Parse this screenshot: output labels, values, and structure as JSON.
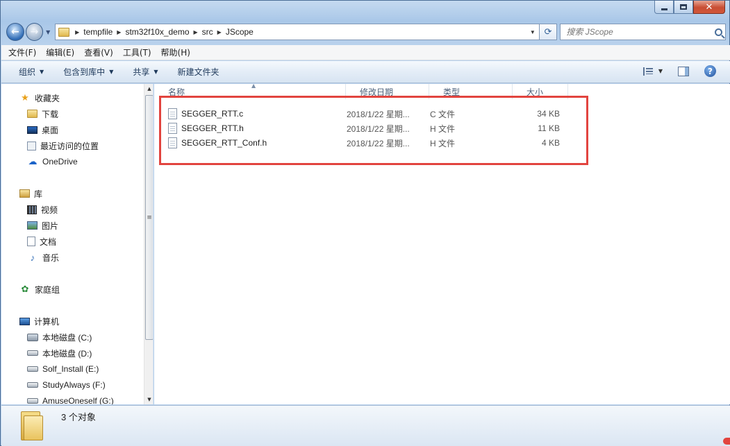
{
  "window": {
    "minimize_icon": "minimize-icon",
    "maximize_icon": "maximize-icon",
    "close_icon": "close-icon"
  },
  "address": {
    "crumbs": [
      "tempfile",
      "stm32f10x_demo",
      "src",
      "JScope"
    ]
  },
  "search": {
    "placeholder": "搜索 JScope"
  },
  "menu": [
    "文件(F)",
    "编辑(E)",
    "查看(V)",
    "工具(T)",
    "帮助(H)"
  ],
  "commands": [
    "组织",
    "包含到库中",
    "共享",
    "新建文件夹"
  ],
  "sidebar": {
    "favorites": {
      "label": "收藏夹",
      "items": [
        "下载",
        "桌面",
        "最近访问的位置",
        "OneDrive"
      ]
    },
    "libraries": {
      "label": "库",
      "items": [
        "视频",
        "图片",
        "文档",
        "音乐"
      ]
    },
    "homegroup": {
      "label": "家庭组"
    },
    "computer": {
      "label": "计算机",
      "items": [
        "本地磁盘 (C:)",
        "本地磁盘 (D:)",
        "Solf_Install (E:)",
        "StudyAlways (F:)",
        "AmuseOneself (G:)"
      ]
    }
  },
  "columns": [
    "名称",
    "修改日期",
    "类型",
    "大小"
  ],
  "files": [
    {
      "name": "SEGGER_RTT.c",
      "date": "2018/1/22 星期...",
      "type": "C 文件",
      "size": "34 KB"
    },
    {
      "name": "SEGGER_RTT.h",
      "date": "2018/1/22 星期...",
      "type": "H 文件",
      "size": "11 KB"
    },
    {
      "name": "SEGGER_RTT_Conf.h",
      "date": "2018/1/22 星期...",
      "type": "H 文件",
      "size": "4 KB"
    }
  ],
  "status": {
    "text": "3 个对象"
  },
  "colors": {
    "highlight": "#e2443f",
    "accent": "#1e395b"
  }
}
